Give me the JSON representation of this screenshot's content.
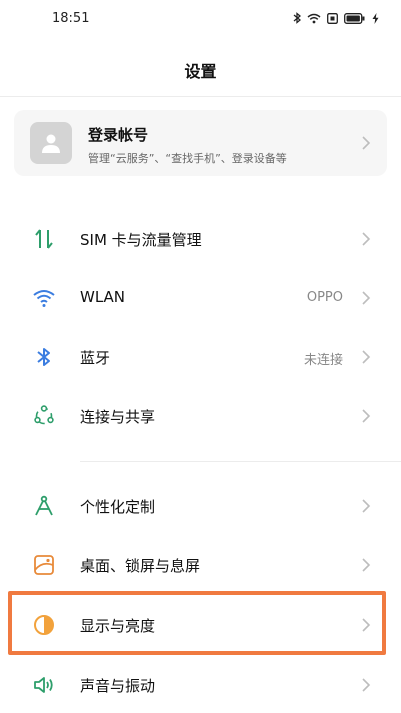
{
  "status_bar": {
    "time": "18:51"
  },
  "page_title": "设置",
  "account": {
    "title": "登录帐号",
    "subtitle": "管理“云服务”、“查找手机”、登录设备等"
  },
  "rows": [
    {
      "label": "SIM 卡与流量管理",
      "value": "",
      "icon": "sim-data-icon"
    },
    {
      "label": "WLAN",
      "value": "OPPO",
      "icon": "wifi-icon"
    },
    {
      "label": "蓝牙",
      "value": "未连接",
      "icon": "bluetooth-icon"
    },
    {
      "label": "连接与共享",
      "value": "",
      "icon": "share-network-icon"
    },
    {
      "label": "个性化定制",
      "value": "",
      "icon": "compass-icon"
    },
    {
      "label": "桌面、锁屏与息屏",
      "value": "",
      "icon": "wallpaper-icon"
    },
    {
      "label": "显示与亮度",
      "value": "",
      "icon": "brightness-icon"
    },
    {
      "label": "声音与振动",
      "value": "",
      "icon": "sound-icon"
    }
  ],
  "colors": {
    "accent_green": "#2e9e6b",
    "accent_orange": "#f2a23c",
    "highlight": "#f07a40",
    "chevron": "#bdbdbd"
  }
}
